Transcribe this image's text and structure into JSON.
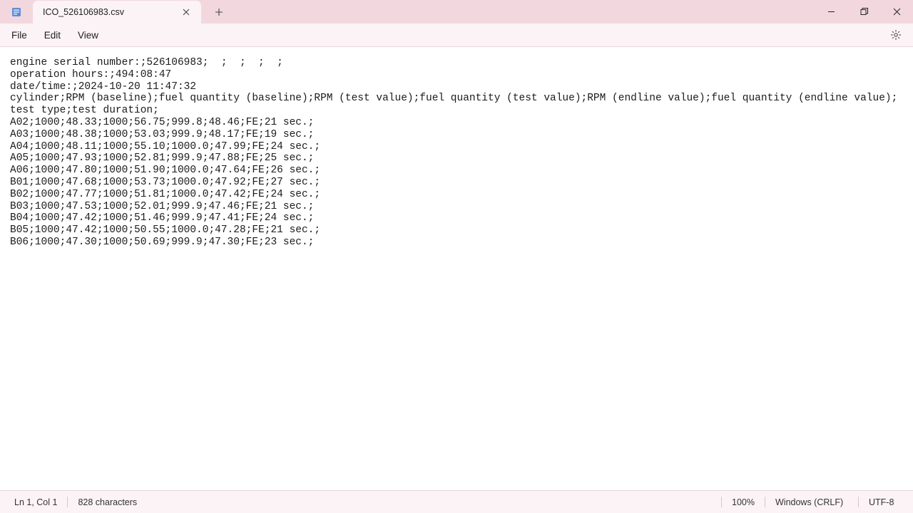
{
  "tab": {
    "title": "ICO_526106983.csv"
  },
  "menu": {
    "file": "File",
    "edit": "Edit",
    "view": "View"
  },
  "editor": {
    "lines": [
      "engine serial number:;526106983;  ;  ;  ;  ;",
      "operation hours:;494:08:47",
      "date/time:;2024-10-20 11:47:32",
      "cylinder;RPM (baseline);fuel quantity (baseline);RPM (test value);fuel quantity (test value);RPM (endline value);fuel quantity (endline value);test type;test duration;",
      "A02;1000;48.33;1000;56.75;999.8;48.46;FE;21 sec.;",
      "A03;1000;48.38;1000;53.03;999.9;48.17;FE;19 sec.;",
      "A04;1000;48.11;1000;55.10;1000.0;47.99;FE;24 sec.;",
      "A05;1000;47.93;1000;52.81;999.9;47.88;FE;25 sec.;",
      "A06;1000;47.80;1000;51.90;1000.0;47.64;FE;26 sec.;",
      "B01;1000;47.68;1000;53.73;1000.0;47.92;FE;27 sec.;",
      "B02;1000;47.77;1000;51.81;1000.0;47.42;FE;24 sec.;",
      "B03;1000;47.53;1000;52.01;999.9;47.46;FE;21 sec.;",
      "B04;1000;47.42;1000;51.46;999.9;47.41;FE;24 sec.;",
      "B05;1000;47.42;1000;50.55;1000.0;47.28;FE;21 sec.;",
      "B06;1000;47.30;1000;50.69;999.9;47.30;FE;23 sec.;"
    ]
  },
  "status": {
    "position": "Ln 1, Col 1",
    "chars": "828 characters",
    "zoom": "100%",
    "lineending": "Windows (CRLF)",
    "encoding": "UTF-8"
  }
}
